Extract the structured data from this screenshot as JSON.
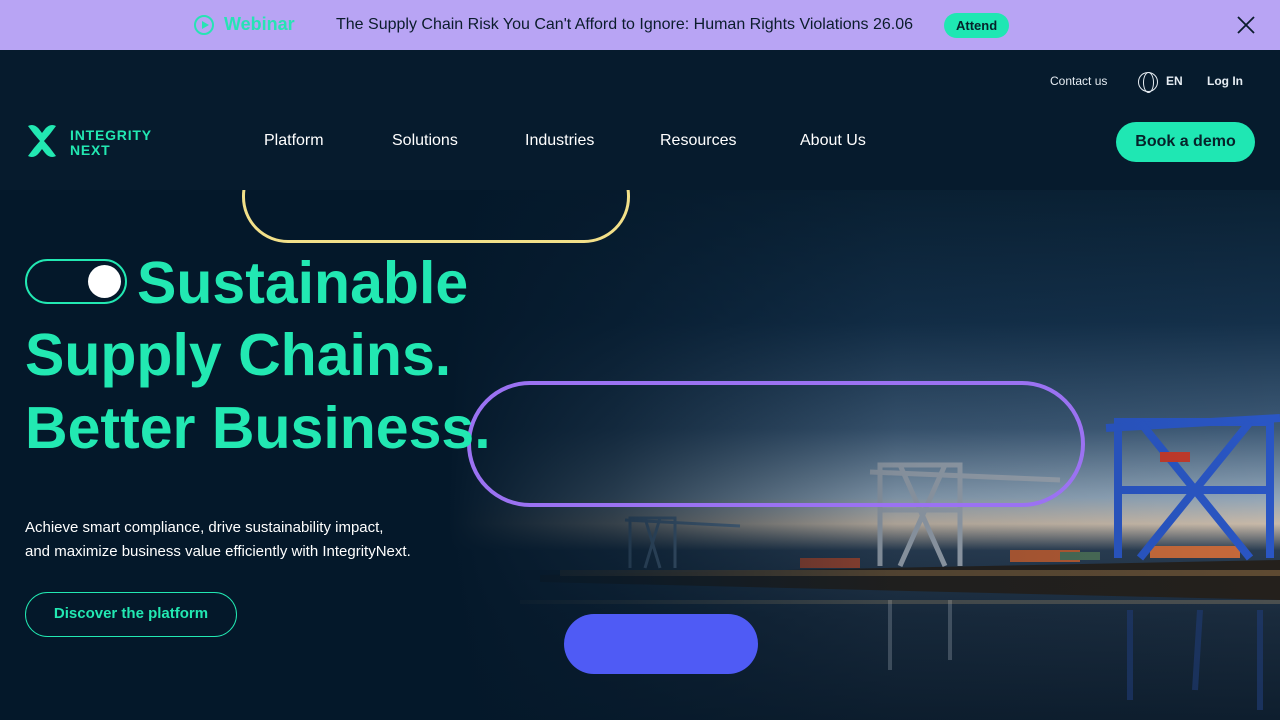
{
  "banner": {
    "tag": "Webinar",
    "message": "The Supply Chain Risk You Can't Afford to Ignore: Human Rights Violations 26.06",
    "cta": "Attend",
    "icon": "play-circle-icon",
    "close_icon": "close-icon"
  },
  "header": {
    "contact": "Contact us",
    "language": "EN",
    "login": "Log In",
    "logo_line1": "INTEGRITY",
    "logo_line2": "NEXT",
    "nav": [
      "Platform",
      "Solutions",
      "Industries",
      "Resources",
      "About Us"
    ],
    "cta": "Book a demo"
  },
  "hero": {
    "headline": [
      "Sustainable",
      "Supply Chains.",
      "Better Business."
    ],
    "subtext_line1": "Achieve smart compliance, drive sustainability impact,",
    "subtext_line2": "and maximize business value efficiently with IntegrityNext.",
    "cta": "Discover the platform"
  },
  "colors": {
    "accent": "#22e8b2",
    "banner_bg": "#b8a4f4",
    "header_bg": "#061b2d",
    "pill_yellow": "#f2e089",
    "pill_purple": "#9b72f2",
    "pill_blue": "#4f5bf5"
  }
}
